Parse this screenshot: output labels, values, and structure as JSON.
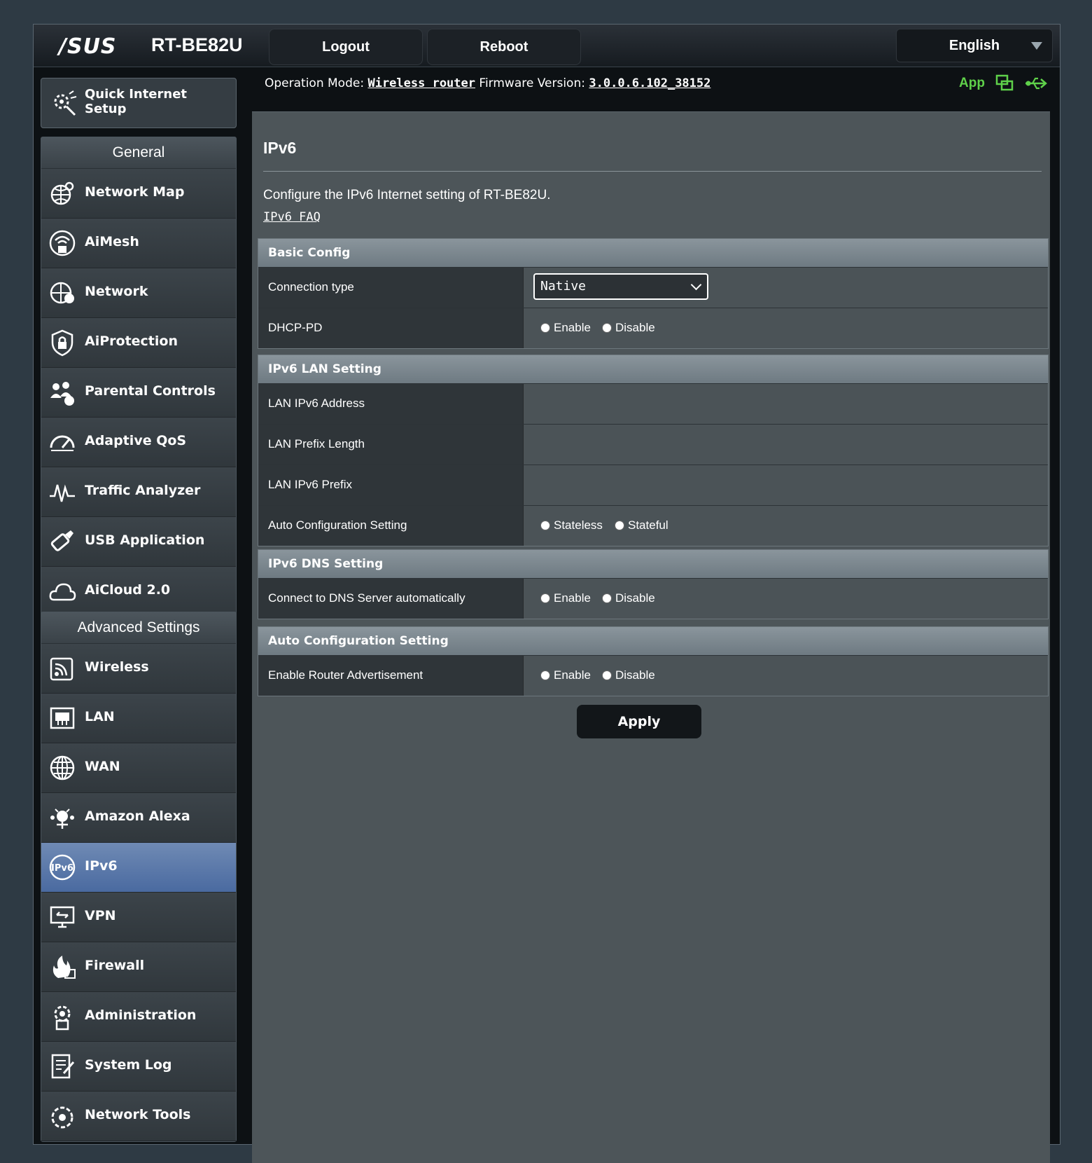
{
  "header": {
    "brand": "/SUS",
    "model": "RT-BE82U",
    "logout": "Logout",
    "reboot": "Reboot",
    "language": "English",
    "op_mode_label": "Operation Mode:",
    "op_mode_value": "Wireless router",
    "fw_label": "Firmware Version:",
    "fw_value": "3.0.0.6.102_38152",
    "app_label": "App"
  },
  "sidebar": {
    "quick_setup": "Quick Internet Setup",
    "general_title": "General",
    "general_items": [
      {
        "label": "Network Map",
        "icon": "network-map-icon"
      },
      {
        "label": "AiMesh",
        "icon": "aimesh-icon"
      },
      {
        "label": "Network",
        "icon": "network-icon"
      },
      {
        "label": "AiProtection",
        "icon": "aiprotection-icon"
      },
      {
        "label": "Parental Controls",
        "icon": "parental-controls-icon"
      },
      {
        "label": "Adaptive QoS",
        "icon": "qos-icon"
      },
      {
        "label": "Traffic Analyzer",
        "icon": "traffic-analyzer-icon"
      },
      {
        "label": "USB Application",
        "icon": "usb-icon"
      },
      {
        "label": "AiCloud 2.0",
        "icon": "cloud-icon"
      }
    ],
    "advanced_title": "Advanced Settings",
    "advanced_items": [
      {
        "label": "Wireless",
        "icon": "wireless-icon"
      },
      {
        "label": "LAN",
        "icon": "lan-icon"
      },
      {
        "label": "WAN",
        "icon": "wan-icon"
      },
      {
        "label": "Amazon Alexa",
        "icon": "alexa-icon"
      },
      {
        "label": "IPv6",
        "icon": "ipv6-icon",
        "active": true
      },
      {
        "label": "VPN",
        "icon": "vpn-icon"
      },
      {
        "label": "Firewall",
        "icon": "firewall-icon"
      },
      {
        "label": "Administration",
        "icon": "administration-icon"
      },
      {
        "label": "System Log",
        "icon": "system-log-icon"
      },
      {
        "label": "Network Tools",
        "icon": "network-tools-icon"
      }
    ]
  },
  "main": {
    "title": "IPv6",
    "description": "Configure the IPv6 Internet setting of RT-BE82U.",
    "faq": "IPv6 FAQ",
    "basic": {
      "header": "Basic Config",
      "conn_type_label": "Connection type",
      "conn_type_value": "Native",
      "dhcp_pd_label": "DHCP-PD",
      "enable": "Enable",
      "disable": "Disable"
    },
    "lan": {
      "header": "IPv6 LAN Setting",
      "addr_label": "LAN IPv6 Address",
      "prefix_len_label": "LAN Prefix Length",
      "prefix_label": "LAN IPv6 Prefix",
      "auto_label": "Auto Configuration Setting",
      "stateless": "Stateless",
      "stateful": "Stateful"
    },
    "dns": {
      "header": "IPv6 DNS Setting",
      "auto_label": "Connect to DNS Server automatically",
      "enable": "Enable",
      "disable": "Disable"
    },
    "autoconf": {
      "header": "Auto Configuration Setting",
      "ra_label": "Enable Router Advertisement",
      "enable": "Enable",
      "disable": "Disable"
    },
    "apply": "Apply"
  },
  "colors": {
    "accent_green": "#5fd14a",
    "active_item": "#5b78a8"
  }
}
